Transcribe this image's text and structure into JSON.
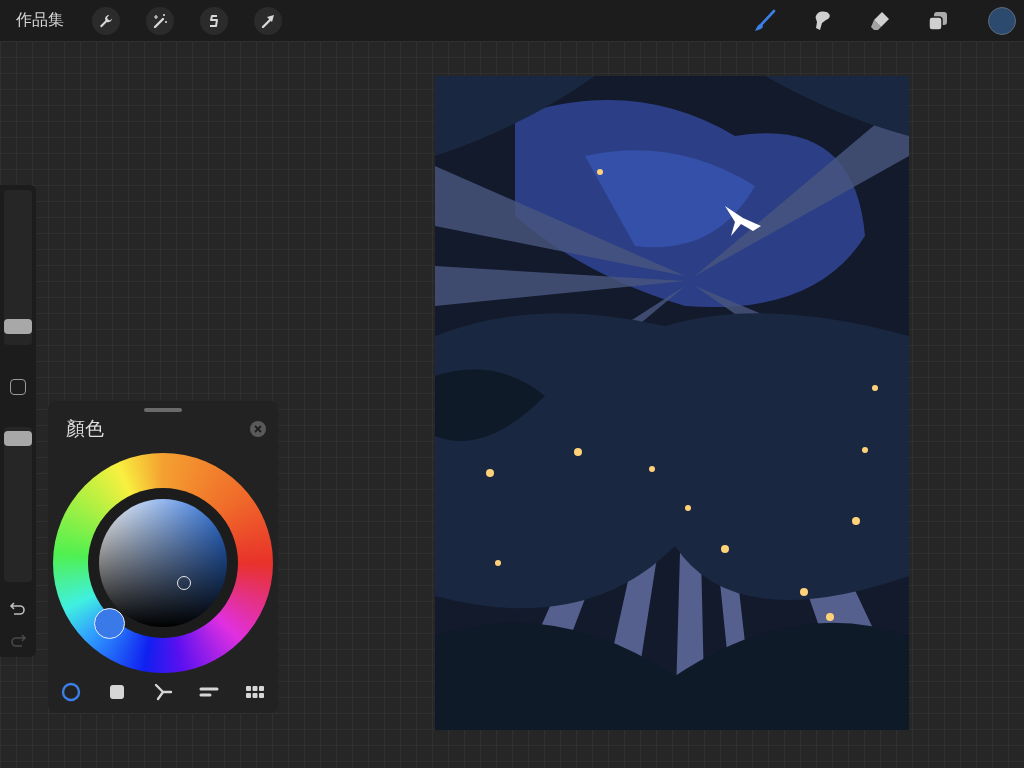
{
  "top_bar": {
    "gallery_label": "作品集",
    "left_tools": [
      {
        "kind": "wrench",
        "selected": false
      },
      {
        "kind": "magic",
        "selected": false
      },
      {
        "kind": "selection",
        "selected": false
      },
      {
        "kind": "transform",
        "selected": false
      }
    ],
    "right_tools": [
      {
        "kind": "brush",
        "selected": true
      },
      {
        "kind": "smudge",
        "selected": false
      },
      {
        "kind": "eraser",
        "selected": false
      },
      {
        "kind": "layers",
        "selected": false
      }
    ],
    "color_swatch": {
      "color": "#2c4a6e"
    }
  },
  "sidebar": {
    "size_slider": {
      "level": 0.08
    },
    "opacity_slider": {
      "level": 0.97
    },
    "undo": {
      "disabled": false
    },
    "redo": {
      "disabled": true
    }
  },
  "color_panel": {
    "title": "顏色",
    "modes": [
      {
        "kind": "disc",
        "selected": true
      },
      {
        "kind": "classic",
        "selected": false
      },
      {
        "kind": "harmony",
        "selected": false
      },
      {
        "kind": "value",
        "selected": false
      },
      {
        "kind": "palettes",
        "selected": false
      }
    ]
  }
}
